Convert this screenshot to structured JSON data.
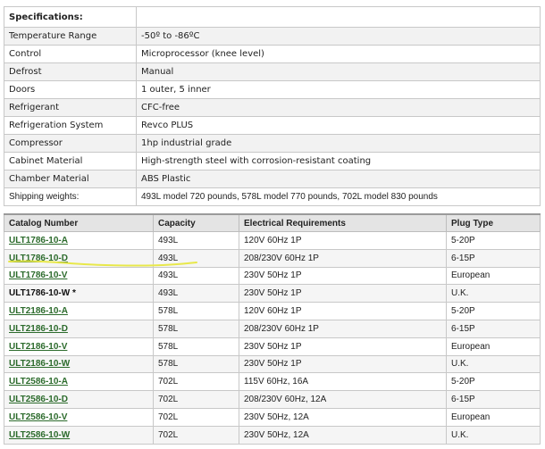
{
  "specifications": {
    "title": "Specifications:",
    "rows": [
      {
        "label": "Temperature Range",
        "value": "-50º to -86ºC"
      },
      {
        "label": "Control",
        "value": "Microprocessor (knee level)"
      },
      {
        "label": "Defrost",
        "value": "Manual"
      },
      {
        "label": "Doors",
        "value": "1 outer, 5 inner"
      },
      {
        "label": "Refrigerant",
        "value": "CFC-free"
      },
      {
        "label": "Refrigeration System",
        "value": "Revco PLUS"
      },
      {
        "label": "Compressor",
        "value": "1hp industrial grade"
      },
      {
        "label": "Cabinet Material",
        "value": "High-strength steel with corrosion-resistant coating"
      },
      {
        "label": "Chamber Material",
        "value": "ABS Plastic"
      },
      {
        "label": "Shipping weights:",
        "value": "493L model 720 pounds, 578L model 770 pounds, 702L model 830 pounds"
      }
    ]
  },
  "catalog": {
    "headers": {
      "catalog_number": "Catalog  Number",
      "capacity": "Capacity",
      "electrical": "Electrical Requirements",
      "plug": "Plug Type"
    },
    "rows": [
      {
        "catalog": "ULT1786-10-A",
        "capacity": "493L",
        "electrical": "120V 60Hz 1P",
        "plug": "5-20P"
      },
      {
        "catalog": "ULT1786-10-D",
        "capacity": "493L",
        "electrical": "208/230V 60Hz 1P",
        "plug": "6-15P"
      },
      {
        "catalog": "ULT1786-10-V",
        "capacity": "493L",
        "electrical": "230V 50Hz 1P",
        "plug": "European"
      },
      {
        "catalog": "ULT1786-10-W *",
        "capacity": "493L",
        "electrical": "230V 50Hz 1P",
        "plug": "U.K."
      },
      {
        "catalog": "ULT2186-10-A",
        "capacity": "578L",
        "electrical": "120V 60Hz 1P",
        "plug": "5-20P"
      },
      {
        "catalog": "ULT2186-10-D",
        "capacity": "578L",
        "electrical": "208/230V 60Hz 1P",
        "plug": "6-15P"
      },
      {
        "catalog": "ULT2186-10-V",
        "capacity": "578L",
        "electrical": "230V 50Hz 1P",
        "plug": "European"
      },
      {
        "catalog": "ULT2186-10-W",
        "capacity": "578L",
        "electrical": "230V 50Hz 1P",
        "plug": "U.K."
      },
      {
        "catalog": "ULT2586-10-A",
        "capacity": "702L",
        "electrical": "115V 60Hz, 16A",
        "plug": "5-20P"
      },
      {
        "catalog": "ULT2586-10-D",
        "capacity": "702L",
        "electrical": "208/230V 60Hz, 12A",
        "plug": "6-15P"
      },
      {
        "catalog": "ULT2586-10-V",
        "capacity": "702L",
        "electrical": "230V 50Hz, 12A",
        "plug": "European"
      },
      {
        "catalog": "ULT2586-10-W",
        "capacity": "702L",
        "electrical": "230V 50Hz, 12A",
        "plug": "U.K."
      }
    ]
  },
  "colors": {
    "link": "#2c6b2c",
    "highlight": "#e8e84a"
  }
}
